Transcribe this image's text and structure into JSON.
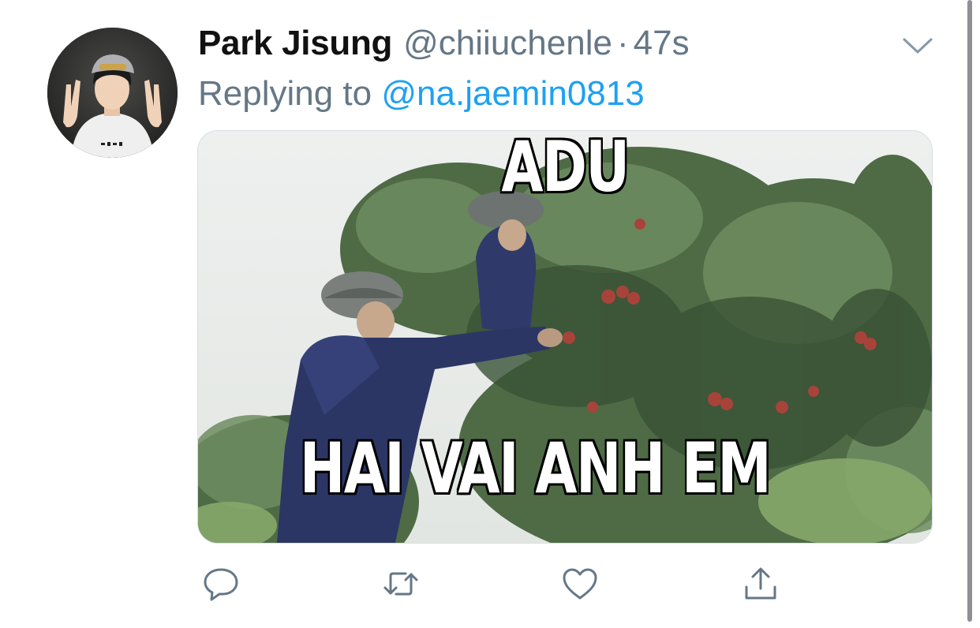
{
  "tweet": {
    "display_name": "Park Jisung",
    "handle": "@chiiuchenle",
    "separator": "·",
    "time": "47s",
    "reply_prefix": "Replying to",
    "reply_mention": "@na.jaemin0813",
    "media": {
      "top_text": "ADU",
      "bottom_text": "HAI VAI ANH EM"
    }
  },
  "icons": {
    "caret": "chevron-down-icon",
    "reply": "reply-bubble-icon",
    "retweet": "retweet-icon",
    "like": "heart-icon",
    "share": "share-upload-icon"
  },
  "colors": {
    "link": "#1da1f2",
    "secondary_text": "#657786",
    "icon": "#657786"
  }
}
